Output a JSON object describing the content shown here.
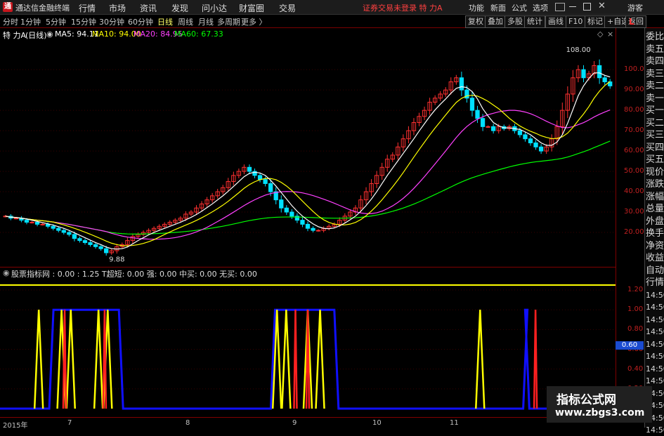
{
  "title_bar": {
    "logo": "通",
    "app_title": "通达信金融终端",
    "menus": [
      "行情",
      "市场",
      "资讯",
      "发现",
      "问小达",
      "财富圈",
      "交易"
    ],
    "status": "证券交易未登录  特 力A",
    "right_menus": [
      "功能",
      "新面",
      "公式",
      "选项"
    ],
    "guest": "游客"
  },
  "toolbar": {
    "periods": [
      "分时",
      "1分钟",
      "5分钟",
      "15分钟",
      "30分钟",
      "60分钟",
      "日线",
      "周线",
      "月线",
      "多周期",
      "更多 〉"
    ],
    "active_period": "日线",
    "right_buttons": [
      "复权",
      "叠加",
      "多股",
      "统计",
      "画线",
      "F10",
      "标记",
      "+自选",
      "返回"
    ]
  },
  "main_header": {
    "name": "特 力A",
    "period": "(日线)",
    "ma": [
      {
        "label": "MA5: 94.11",
        "color": "#ffffff"
      },
      {
        "label": "MA10: 94.00",
        "color": "#ffff00"
      },
      {
        "label": "MA20: 84.95",
        "color": "#ff40ff"
      },
      {
        "label": "MA60: 67.33",
        "color": "#00ff00"
      }
    ]
  },
  "price_axis": {
    "label": "L",
    "min": 10,
    "max": 108,
    "ticks": [
      "100.00",
      "90.00",
      "80.00",
      "70.00",
      "60.00",
      "50.00",
      "40.00",
      "30.00",
      "20.00"
    ],
    "annotations": {
      "high": "108.00",
      "low": "9.88"
    }
  },
  "indicator": {
    "header": "股票指标网 : 0.00 : 1.25  T超短: 0.00  强: 0.00  中买: 0.00  无买: 0.00",
    "ticks": [
      "1.20",
      "1.00",
      "0.80",
      "0.60",
      "0.40",
      "0.20"
    ],
    "current": "0.60"
  },
  "x_axis": [
    "2015年",
    "7",
    "8",
    "9",
    "10",
    "11"
  ],
  "side_panel": [
    "委比",
    "卖五",
    "卖四",
    "卖三",
    "卖二",
    "卖一",
    "买一",
    "买二",
    "买三",
    "买四",
    "买五",
    "现价",
    "涨跌",
    "涨幅",
    "总量",
    "外盘",
    "换手",
    "净资",
    "收益",
    "自动",
    "行情",
    "14:50",
    "14:50",
    "14:50",
    "14:50",
    "14:50",
    "14:50",
    "14:50",
    "14:50",
    "14:50",
    "14:50",
    "14:50",
    "14:50"
  ],
  "watermark": {
    "line1": "指标公式网",
    "line2": "www.zbgs3.com"
  },
  "colors": {
    "up": "#ff3030",
    "down": "#00e0ff",
    "ma5": "#ffffff",
    "ma10": "#ffff00",
    "ma20": "#ff40ff",
    "ma60": "#00ff00",
    "indicator_blue": "#1010ff",
    "indicator_yellow": "#ffff00",
    "indicator_red": "#ff2020"
  },
  "chart_data": [
    {
      "type": "candlestick",
      "name": "特 力A (日线)",
      "ylim": [
        10,
        108
      ],
      "close": [
        28,
        27,
        27,
        26,
        25,
        25,
        24,
        24,
        23,
        22,
        21,
        20,
        19,
        17,
        16,
        15,
        14,
        13,
        12,
        10,
        11,
        13,
        14,
        16,
        18,
        19,
        20,
        21,
        22,
        23,
        24,
        25,
        26,
        27,
        29,
        30,
        32,
        34,
        36,
        38,
        40,
        42,
        45,
        48,
        50,
        52,
        50,
        48,
        46,
        44,
        40,
        36,
        32,
        30,
        28,
        26,
        24,
        22,
        21,
        21,
        22,
        23,
        24,
        26,
        28,
        30,
        32,
        36,
        40,
        44,
        48,
        52,
        56,
        58,
        62,
        66,
        70,
        74,
        77,
        80,
        84,
        86,
        88,
        90,
        94,
        96,
        90,
        86,
        80,
        76,
        72,
        72,
        70,
        72,
        71,
        72,
        70,
        68,
        66,
        64,
        62,
        60,
        62,
        66,
        72,
        80,
        88,
        96,
        100,
        96,
        98,
        102,
        96,
        94,
        92
      ]
    },
    {
      "type": "line",
      "name": "indicator",
      "ylim": [
        0,
        1.25
      ],
      "series": [
        {
          "color": "#1010ff",
          "segments": [
            [
              0.08,
              0.2,
              1.0
            ],
            [
              0.44,
              0.55,
              1.0
            ],
            [
              0.85,
              0.86,
              1.0
            ]
          ]
        },
        {
          "color": "#ffff00",
          "spikes": [
            0.063,
            0.1,
            0.115,
            0.16,
            0.175,
            0.45,
            0.465,
            0.5,
            0.52,
            0.78
          ]
        },
        {
          "color": "#ff2020",
          "spikes": [
            0.105,
            0.17,
            0.48,
            0.5,
            0.87
          ]
        }
      ]
    }
  ]
}
